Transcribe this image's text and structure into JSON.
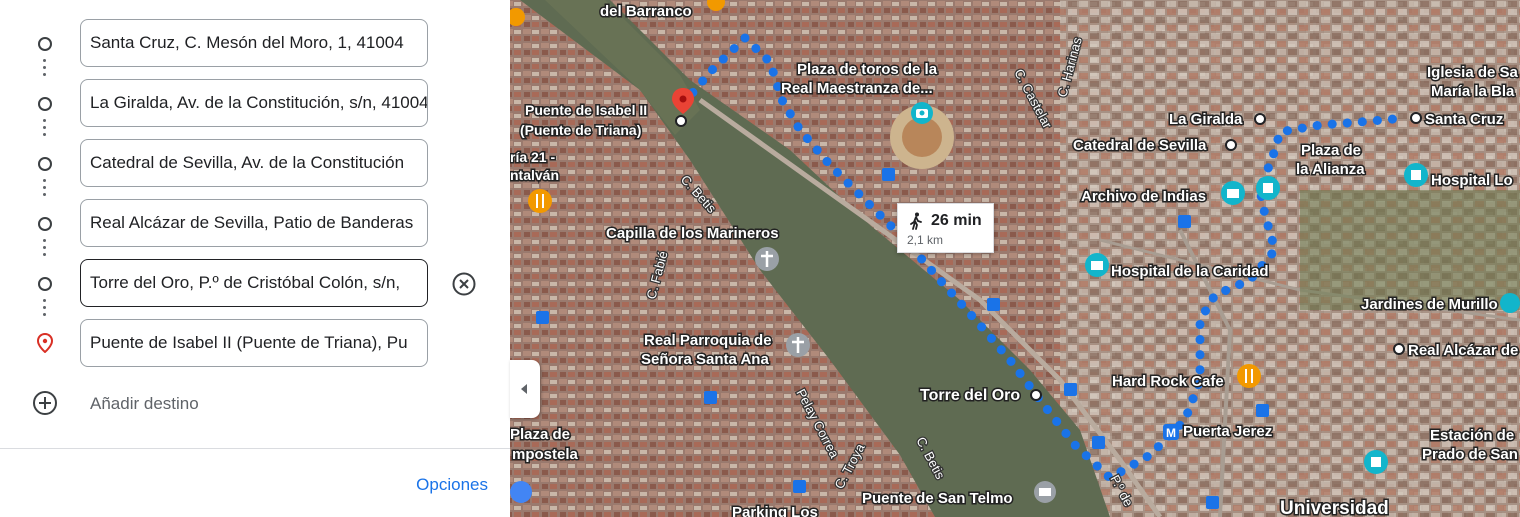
{
  "directions": {
    "stops": [
      {
        "value": "Santa Cruz, C. Mesón del Moro, 1, 41004",
        "icon": "waypoint-circle-icon"
      },
      {
        "value": "La Giralda, Av. de la Constitución, s/n, 41004",
        "icon": "waypoint-circle-icon"
      },
      {
        "value": "Catedral de Sevilla, Av. de la Constitución",
        "icon": "waypoint-circle-icon"
      },
      {
        "value": "Real Alcázar de Sevilla, Patio de Banderas",
        "icon": "waypoint-circle-icon"
      },
      {
        "value": "Torre del Oro, P.º de Cristóbal Colón, s/n,",
        "icon": "waypoint-circle-icon"
      },
      {
        "value": "Puente de Isabel II (Puente de Triana), Pu",
        "icon": "destination-pin-icon"
      }
    ],
    "add_destination_label": "Añadir destino",
    "options_label": "Opciones"
  },
  "map": {
    "route": {
      "time": "26 min",
      "distance": "2,1 km",
      "mode_icon": "walking-icon",
      "color": "#1a73e8"
    },
    "labels": {
      "barranco": "del Barranco",
      "plaza_toros_1": "Plaza de toros de la",
      "plaza_toros_2": "Real Maestranza de...",
      "puente_isabel_1": "Puente de Isabel II",
      "puente_isabel_2": "(Puente de Triana)",
      "feria_1": "ría 21 -",
      "feria_2": "ntalván",
      "capilla": "Capilla de los Marineros",
      "parroquia_1": "Real Parroquia de",
      "parroquia_2": "Señora Santa Ana",
      "plaza_compostela_1": "Plaza de",
      "plaza_compostela_2": "mpostela",
      "torre_del_oro": "Torre del Oro",
      "hard_rock": "Hard Rock Cafe",
      "puerta_jerez": "Puerta Jerez",
      "puente_telmo": "Puente de San Telmo",
      "parking": "Parking Los",
      "universidad": "Universidad",
      "hospital_caridad": "Hospital de la Caridad",
      "archivo": "Archivo de Indias",
      "catedral": "Catedral de Sevilla",
      "giralda": "La Giralda",
      "santa_cruz": "Santa Cruz",
      "plaza_alianza_1": "Plaza de",
      "plaza_alianza_2": "la Alianza",
      "iglesia_1": "Iglesia de Sa",
      "iglesia_2": "María la Bla",
      "hospital_lo": "Hospital Lo",
      "jardines": "Jardines de Murillo",
      "real_alcazar": "Real Alcázar de",
      "estacion_1": "Estación de",
      "estacion_2": "Prado de San"
    },
    "streets": {
      "c_castelar": "C. Castelar",
      "c_harinas": "C. Harinas",
      "c_betis_1": "C. Betis",
      "c_betis_2": "C. Betis",
      "c_fabie": "C. Fabié",
      "c_troya": "C. Troya",
      "pelay_correa": "Pelay Correa",
      "p_de": "P.º de"
    }
  }
}
